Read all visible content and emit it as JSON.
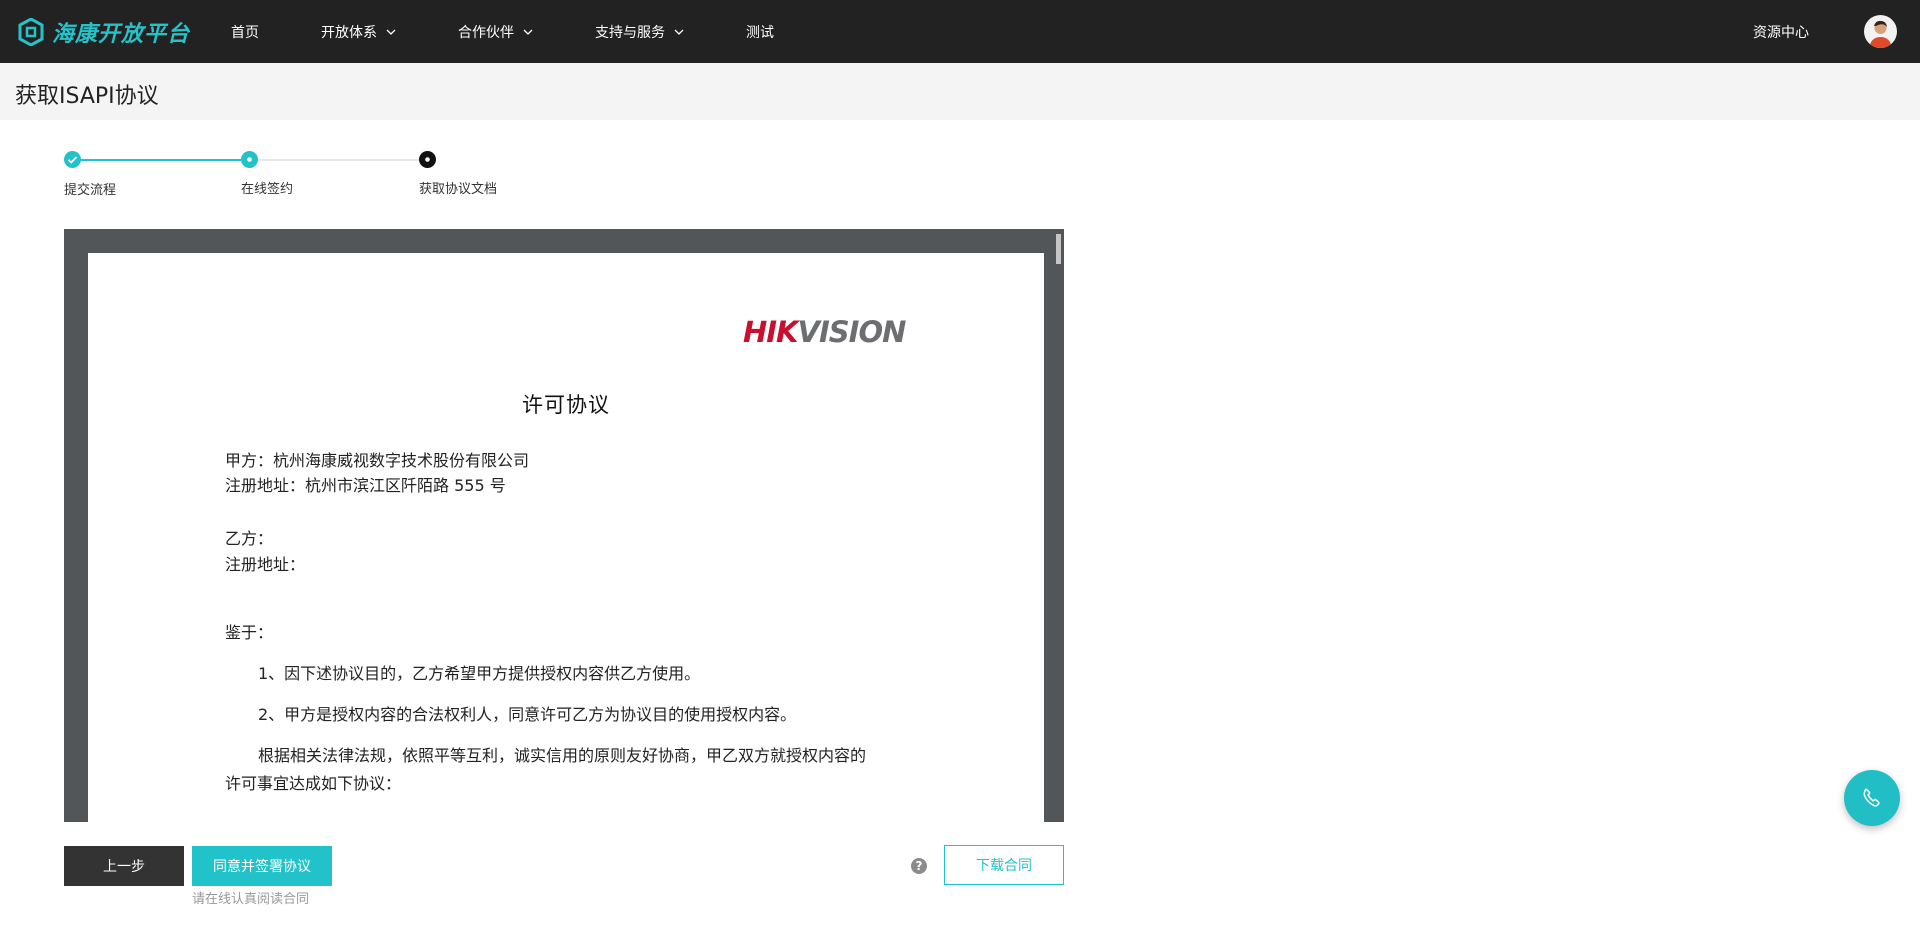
{
  "header": {
    "logo_text": "海康开放平台",
    "nav": [
      {
        "label": "首页"
      },
      {
        "label": "开放体系"
      },
      {
        "label": "合作伙伴"
      },
      {
        "label": "支持与服务"
      },
      {
        "label": "测试"
      }
    ],
    "resource_center": "资源中心"
  },
  "page": {
    "title": "获取ISAPI协议"
  },
  "steps": [
    {
      "label": "提交流程",
      "state": "done"
    },
    {
      "label": "在线签约",
      "state": "current"
    },
    {
      "label": "获取协议文档",
      "state": "pending"
    }
  ],
  "document": {
    "brand_red": "HIK",
    "brand_gray": "VISION",
    "title": "许可协议",
    "lines": [
      "甲方：杭州海康威视数字技术股份有限公司",
      "注册地址：杭州市滨江区阡陌路 555 号",
      "乙方：",
      "注册地址：",
      "鉴于：",
      "1、因下述协议目的，乙方希望甲方提供授权内容供乙方使用。",
      "2、甲方是授权内容的合法权利人，同意许可乙方为协议目的使用授权内容。",
      "根据相关法律法规，依照平等互利，诚实信用的原则友好协商，甲乙双方就授权内容的",
      "许可事宜达成如下协议："
    ]
  },
  "actions": {
    "prev": "上一步",
    "agree": "同意并签署协议",
    "hint": "请在线认真阅读合同",
    "help": "?",
    "download": "下载合同"
  },
  "colors": {
    "accent": "#21c2c9",
    "topbar": "#222222",
    "brand_red": "#c8102e"
  },
  "icons": {
    "fab": "phone-icon",
    "help": "question-icon"
  }
}
